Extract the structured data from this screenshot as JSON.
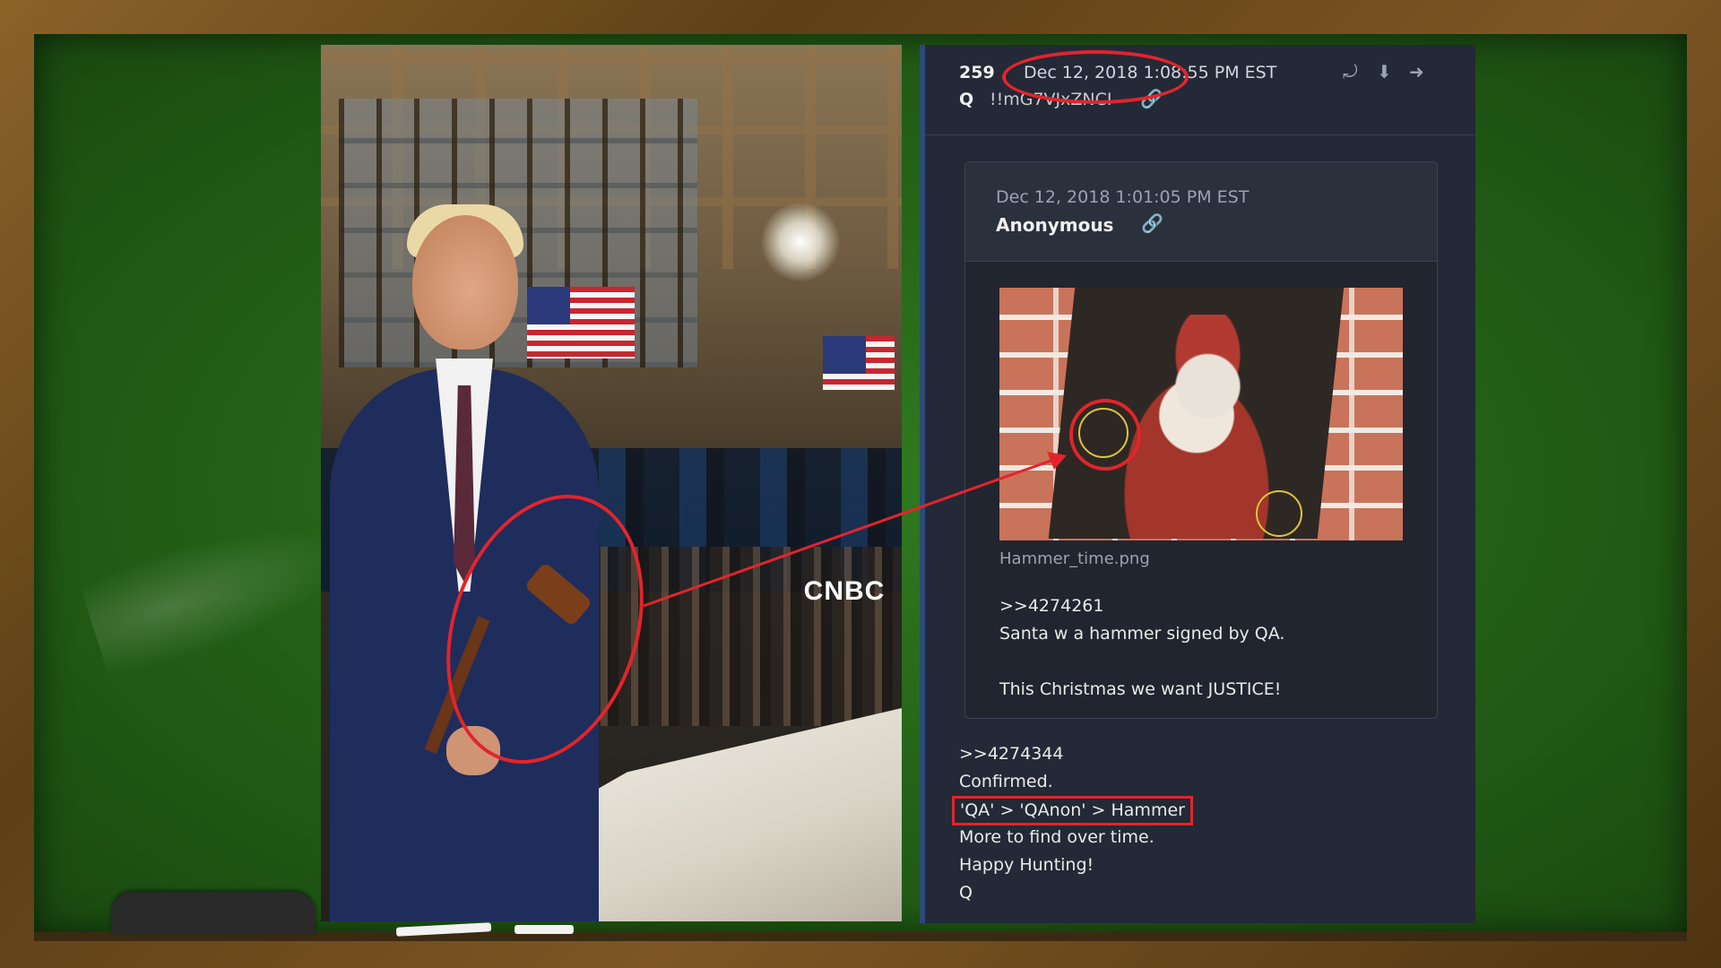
{
  "photo": {
    "network_logo": "CNBC"
  },
  "post": {
    "number": "259",
    "date": "Dec 12, 2018 1:08:55 PM EST",
    "author": "Q",
    "tripcode": "!!mG7VJxZNCI",
    "header_icons": [
      "share-icon",
      "download-icon",
      "reply-arrow-icon"
    ],
    "quoted": {
      "date": "Dec 12, 2018 1:01:05 PM EST",
      "author": "Anonymous",
      "image_filename": "Hammer_time.png",
      "body": [
        ">>4274261",
        "Santa w a hammer signed by QA.",
        "",
        "This Christmas we want JUSTICE!"
      ]
    },
    "reply": [
      ">>4274344",
      "Confirmed.",
      "'QA' > 'QAnon' > Hammer",
      "More to find over time.",
      "Happy Hunting!",
      "Q"
    ]
  },
  "colors": {
    "chalkboard": "#235f16",
    "frame": "#6b4a1f",
    "annotation_red": "#e3242b",
    "post_bg": "#232936",
    "link_blue": "#4a90d9"
  }
}
